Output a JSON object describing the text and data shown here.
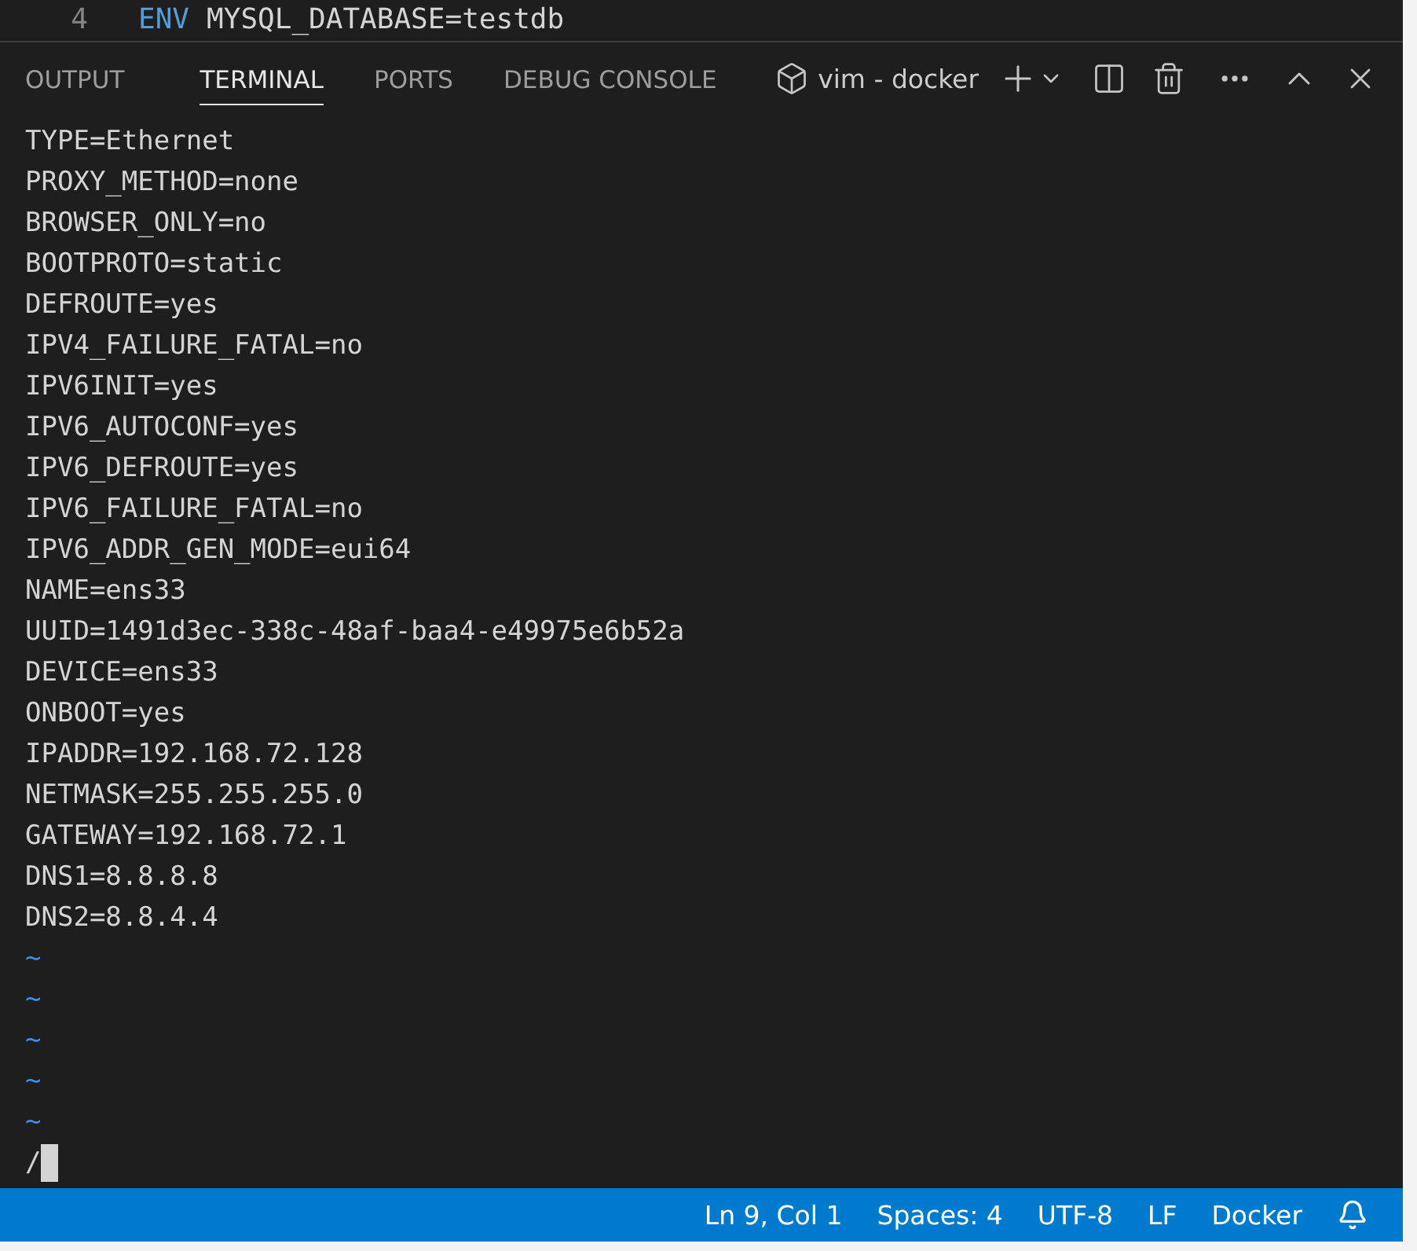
{
  "editor_line": {
    "number": "4",
    "keyword": "ENV",
    "text": "MYSQL_DATABASE=testdb"
  },
  "panel_tabs": [
    {
      "label": "OUTPUT",
      "selected": false
    },
    {
      "label": "TERMINAL",
      "selected": true
    },
    {
      "label": "PORTS",
      "selected": false
    },
    {
      "label": "DEBUG CONSOLE",
      "selected": false
    }
  ],
  "terminal_name": "vim - docker",
  "terminal_lines": [
    {
      "kind": "text",
      "text": "TYPE=Ethernet"
    },
    {
      "kind": "text",
      "text": "PROXY_METHOD=none"
    },
    {
      "kind": "text",
      "text": "BROWSER_ONLY=no"
    },
    {
      "kind": "text",
      "text": "BOOTPROTO=static"
    },
    {
      "kind": "text",
      "text": "DEFROUTE=yes"
    },
    {
      "kind": "text",
      "text": "IPV4_FAILURE_FATAL=no"
    },
    {
      "kind": "text",
      "text": "IPV6INIT=yes"
    },
    {
      "kind": "text",
      "text": "IPV6_AUTOCONF=yes"
    },
    {
      "kind": "text",
      "text": "IPV6_DEFROUTE=yes"
    },
    {
      "kind": "text",
      "text": "IPV6_FAILURE_FATAL=no"
    },
    {
      "kind": "text",
      "text": "IPV6_ADDR_GEN_MODE=eui64"
    },
    {
      "kind": "text",
      "text": "NAME=ens33"
    },
    {
      "kind": "text",
      "text": "UUID=1491d3ec-338c-48af-baa4-e49975e6b52a"
    },
    {
      "kind": "text",
      "text": "DEVICE=ens33"
    },
    {
      "kind": "text",
      "text": "ONBOOT=yes"
    },
    {
      "kind": "text",
      "text": "IPADDR=192.168.72.128"
    },
    {
      "kind": "text",
      "text": "NETMASK=255.255.255.0"
    },
    {
      "kind": "text",
      "text": "GATEWAY=192.168.72.1"
    },
    {
      "kind": "text",
      "text": "DNS1=8.8.8.8"
    },
    {
      "kind": "text",
      "text": "DNS2=8.8.4.4"
    },
    {
      "kind": "tilde",
      "text": "~"
    },
    {
      "kind": "tilde",
      "text": "~"
    },
    {
      "kind": "tilde",
      "text": "~"
    },
    {
      "kind": "tilde",
      "text": "~"
    },
    {
      "kind": "tilde",
      "text": "~"
    },
    {
      "kind": "prompt",
      "text": "/"
    }
  ],
  "status_bar": [
    "Ln 9, Col 1",
    "Spaces: 4",
    "UTF-8",
    "LF",
    "Docker"
  ]
}
